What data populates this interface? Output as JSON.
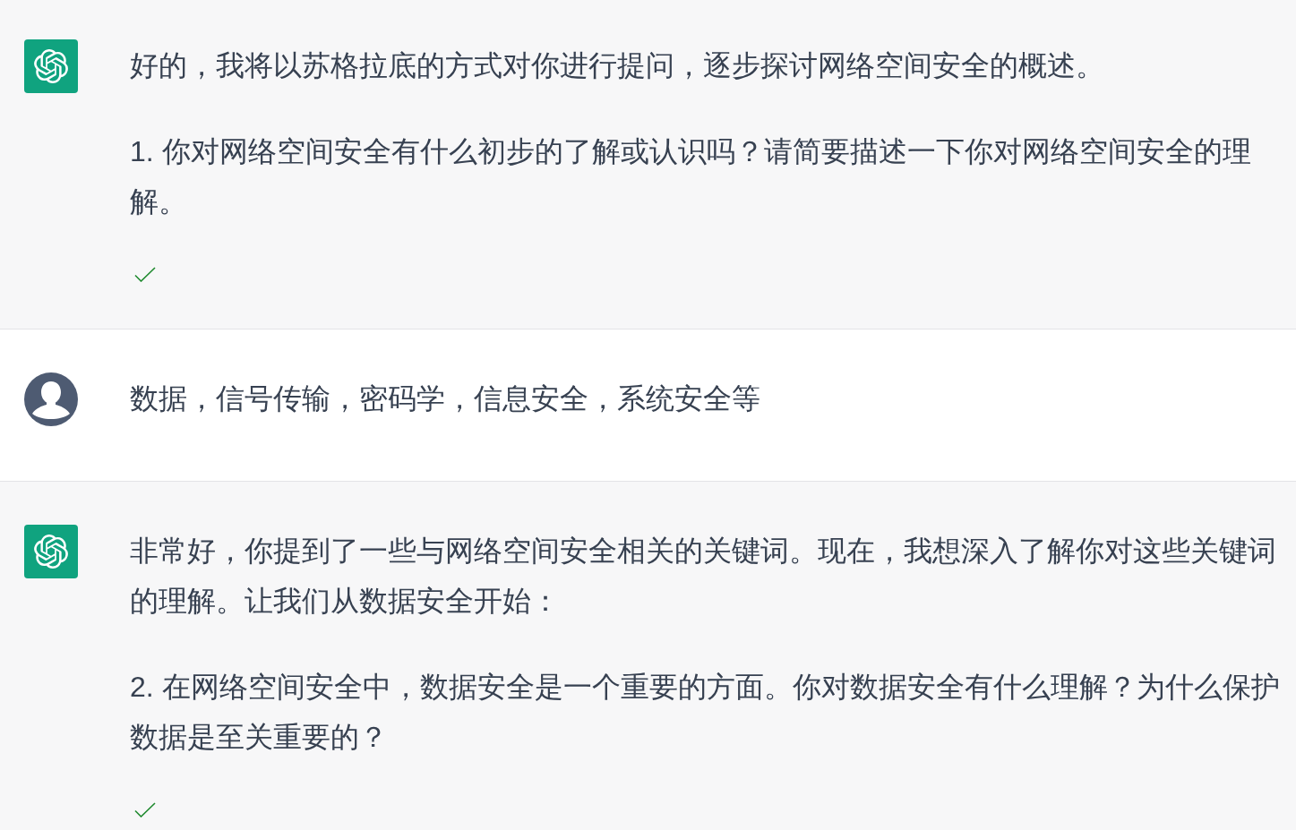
{
  "messages": [
    {
      "kind": "assistant",
      "paragraphs": [
        "好的，我将以苏格拉底的方式对你进行提问，逐步探讨网络空间安全的概述。",
        "1. 你对网络空间安全有什么初步的了解或认识吗？请简要描述一下你对网络空间安全的理解。"
      ],
      "checkmark": true
    },
    {
      "kind": "user",
      "paragraphs": [
        "数据，信号传输，密码学，信息安全，系统安全等"
      ],
      "checkmark": false
    },
    {
      "kind": "assistant",
      "paragraphs": [
        "非常好，你提到了一些与网络空间安全相关的关键词。现在，我想深入了解你对这些关键词的理解。让我们从数据安全开始：",
        "2. 在网络空间安全中，数据安全是一个重要的方面。你对数据安全有什么理解？为什么保护数据是至关重要的？"
      ],
      "checkmark": true
    }
  ]
}
